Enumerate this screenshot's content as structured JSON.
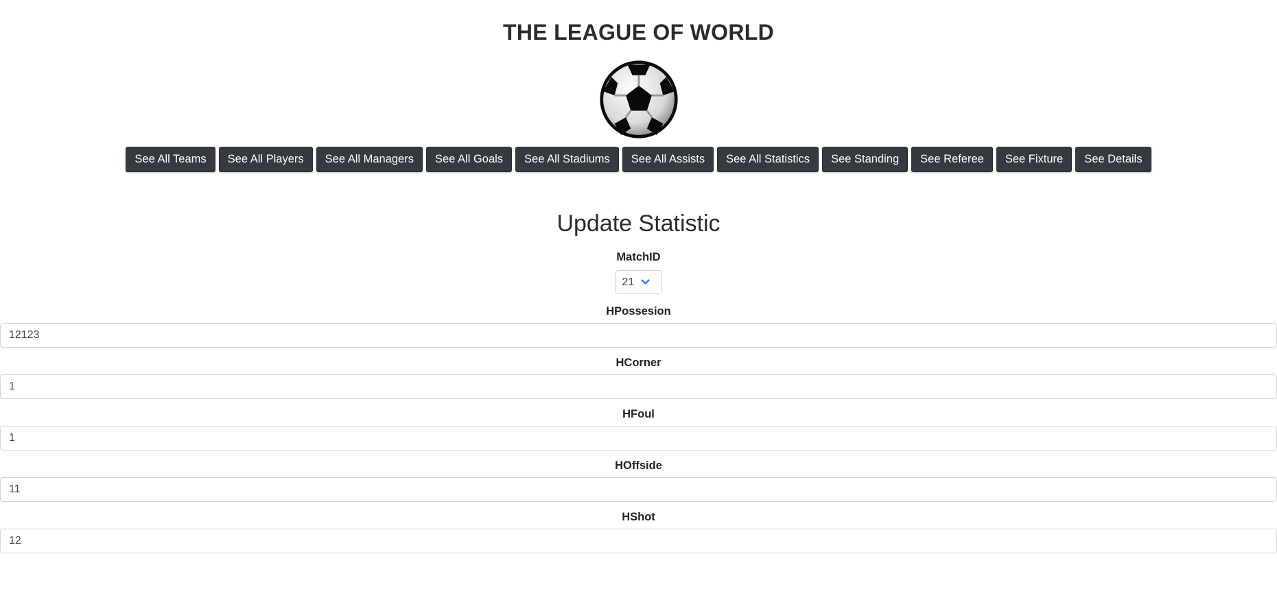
{
  "header": {
    "site_title": "THE LEAGUE OF WORLD",
    "logo_icon": "soccer-ball-icon"
  },
  "nav": {
    "buttons": [
      {
        "label": "See All Teams"
      },
      {
        "label": "See All Players"
      },
      {
        "label": "See All Managers"
      },
      {
        "label": "See All Goals"
      },
      {
        "label": "See All Stadiums"
      },
      {
        "label": "See All Assists"
      },
      {
        "label": "See All Statistics"
      },
      {
        "label": "See Standing"
      },
      {
        "label": "See Referee"
      },
      {
        "label": "See Fixture"
      },
      {
        "label": "See Details"
      }
    ],
    "button_color": "#343a40"
  },
  "form": {
    "title": "Update Statistic",
    "match_id": {
      "label": "MatchID",
      "selected": "21",
      "chevron_color": "#0d6efd"
    },
    "fields": [
      {
        "label": "HPossesion",
        "value": "12123"
      },
      {
        "label": "HCorner",
        "value": "1"
      },
      {
        "label": "HFoul",
        "value": "1"
      },
      {
        "label": "HOffside",
        "value": "11"
      },
      {
        "label": "HShot",
        "value": "12"
      }
    ]
  }
}
